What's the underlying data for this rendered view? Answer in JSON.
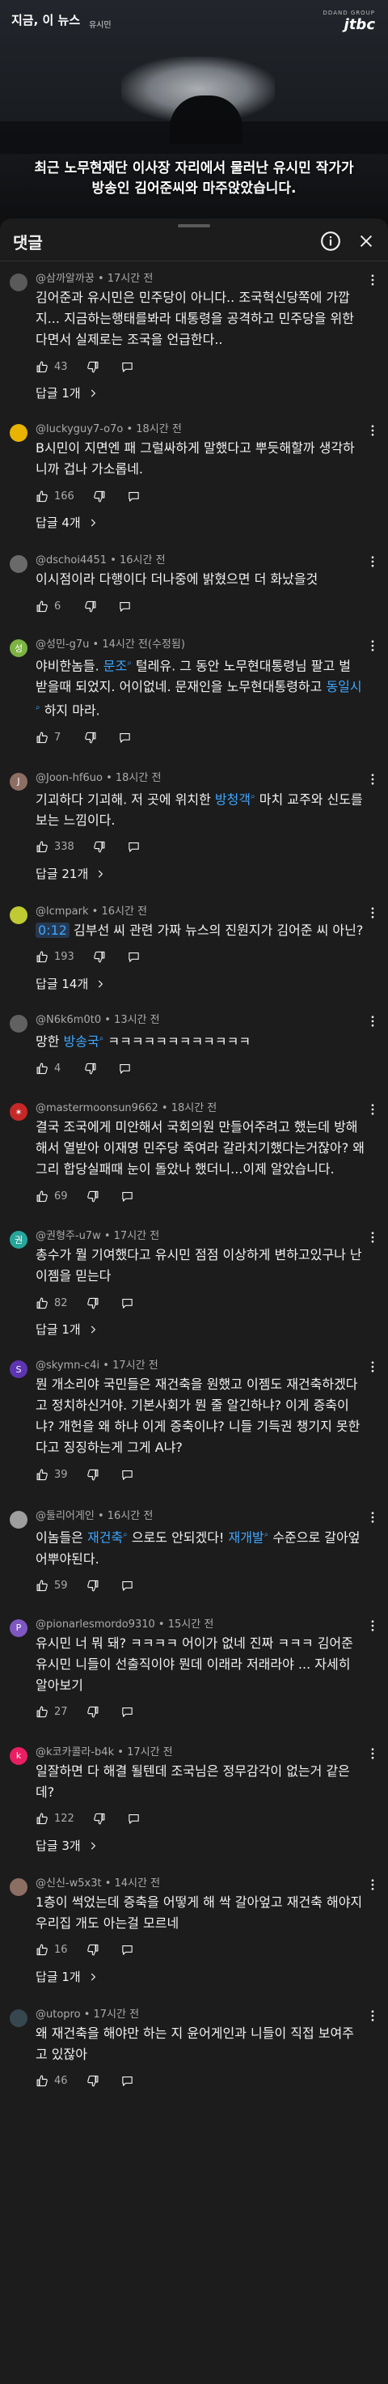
{
  "video": {
    "channel_logo": "지금, 이 뉴스",
    "channel_sub": "유시민",
    "brand_small": "DDAND GROUP",
    "brand_logo": "jtbc",
    "subtitle_line1": "최근 노무현재단 이사장 자리에서 물러난 유시민 작가가",
    "subtitle_line2": "방송인 김어준씨와 마주앉았습니다."
  },
  "sheet": {
    "title": "댓글"
  },
  "comments": [
    {
      "author": "@삼까알까꿍",
      "time": "17시간 전",
      "text": "김어준과 유시민은 민주당이 아니다.. 조국혁신당쪽에 가깝지... 지금하는행태를봐라 대통령을 공격하고 민주당을 위한다면서 실제로는 조국을 언급한다..",
      "likes": "43",
      "replies": "답글 1개",
      "avatar_color": "#5a5a5a",
      "avatar_letter": ""
    },
    {
      "author": "@luckyguy7-o7o",
      "time": "18시간 전",
      "text": "B시민이 지면엔 패 그럴싸하게 말했다고 뿌듯해할까 생각하니까 겁나 가소롭네.",
      "likes": "166",
      "replies": "답글 4개",
      "avatar_color": "#e8b400",
      "avatar_letter": ""
    },
    {
      "author": "@dschoi4451",
      "time": "16시간 전",
      "text": "이시점이라 다행이다 더나중에 밝혔으면 더 화났을것",
      "likes": "6",
      "replies": "",
      "avatar_color": "#6a6a6a",
      "avatar_letter": ""
    },
    {
      "author": "@성민-g7u",
      "time": "14시간 전(수정됨)",
      "text_parts": [
        "야비한놈들. ",
        "문조",
        " 털레유. 그 동안 노무현대통령님 팔고 벌 받을때 되었지. 어이없네. 문재인을 노무현대통령하고 ",
        "동일시",
        " 하지 마라."
      ],
      "likes": "7",
      "replies": "",
      "avatar_color": "#7cb342",
      "avatar_letter": "성"
    },
    {
      "author": "@Joon-hf6uo",
      "time": "18시간 전",
      "text_parts": [
        "기괴하다 기괴해. 저 곳에 위치한 ",
        "방청객",
        " 마치 교주와 신도를 보는 느낌이다."
      ],
      "likes": "338",
      "replies": "답글 21개",
      "avatar_color": "#8d6e63",
      "avatar_letter": "J"
    },
    {
      "author": "@lcmpark",
      "time": "16시간 전",
      "timestamp": "0:12",
      "text": " 김부선 씨 관련 가짜 뉴스의 진원지가 김어준 씨 아닌?",
      "likes": "193",
      "replies": "답글 14개",
      "avatar_color": "#c0ca33",
      "avatar_letter": ""
    },
    {
      "author": "@N6k6m0t0",
      "time": "13시간 전",
      "text_parts": [
        "망한 ",
        "방송국",
        " ㅋㅋㅋㅋㅋㅋㅋㅋㅋㅋㅋㅋ"
      ],
      "likes": "4",
      "replies": "",
      "avatar_color": "#616161",
      "avatar_letter": ""
    },
    {
      "author": "@mastermoonsun9662",
      "time": "18시간 전",
      "text": "결국 조국에게 미안해서 국회의원 만들어주려고 했는데 방해해서 열받아 이재명 민주당 죽여라 갈라치기했다는거잖아? 왜 그리 합당실패때 눈이 돌았나 했더니...이제 알았습니다.",
      "likes": "69",
      "replies": "",
      "avatar_color": "#c62828",
      "avatar_letter": "✶"
    },
    {
      "author": "@권형주-u7w",
      "time": "17시간 전",
      "text": "총수가 뭘 기여했다고 유시민 점점 이상하게 변하고있구나 난 이젬을 믿는다",
      "likes": "82",
      "replies": "답글 1개",
      "avatar_color": "#26a69a",
      "avatar_letter": "권"
    },
    {
      "author": "@skymn-c4i",
      "time": "17시간 전",
      "text": "뭔 개소리야 국민들은 재건축을 원했고 이젬도 재건축하겠다고 정치하신거야. 기본사회가 뭔 줄 알긴하냐? 이게 증축이냐? 개헌을 왜 하냐 이게 증축이냐? 니들 기득권 챙기지 못한다고 징징하는게 그게 A냐?",
      "likes": "39",
      "replies": "",
      "avatar_color": "#5e35b1",
      "avatar_letter": "S"
    },
    {
      "author": "@둘리어게인",
      "time": "16시간 전",
      "text_parts": [
        "이놈들은 ",
        "재건축",
        " 으로도 안되겠다! ",
        "재개발",
        " 수준으로 갈아엎어뿌야된다."
      ],
      "likes": "59",
      "replies": "",
      "avatar_color": "#9e9e9e",
      "avatar_letter": ""
    },
    {
      "author": "@pionarlesmordo9310",
      "time": "15시간 전",
      "text": "유시민 너 뭐 돼? ㅋㅋㅋㅋ 어이가 없네 진짜 ㅋㅋㅋ 김어준 유시민 니들이 선출직이야 뭔데 이래라 저래라야 ... 자세히 알아보기",
      "likes": "27",
      "replies": "",
      "avatar_color": "#7e57c2",
      "avatar_letter": "P"
    },
    {
      "author": "@k코카콜라-b4k",
      "time": "17시간 전",
      "text": "일잘하면 다 해결 될텐데 조국님은 정무감각이 없는거 같은데?",
      "likes": "122",
      "replies": "답글 3개",
      "avatar_color": "#e91e63",
      "avatar_letter": "k"
    },
    {
      "author": "@신신-w5x3t",
      "time": "14시간 전",
      "text": "1층이 썩었는데 증축을 어떻게 해 싹 갈아엎고 재건축 해야지 우리집 개도 아는걸 모르네",
      "likes": "16",
      "replies": "답글 1개",
      "avatar_color": "#8d6e63",
      "avatar_letter": ""
    },
    {
      "author": "@utopro",
      "time": "17시간 전",
      "text": "왜 재건축을 해야만 하는 지 윤어게인과 니들이 직접 보여주고 있잖아",
      "likes": "46",
      "replies": "",
      "avatar_color": "#37474f",
      "avatar_letter": ""
    }
  ]
}
